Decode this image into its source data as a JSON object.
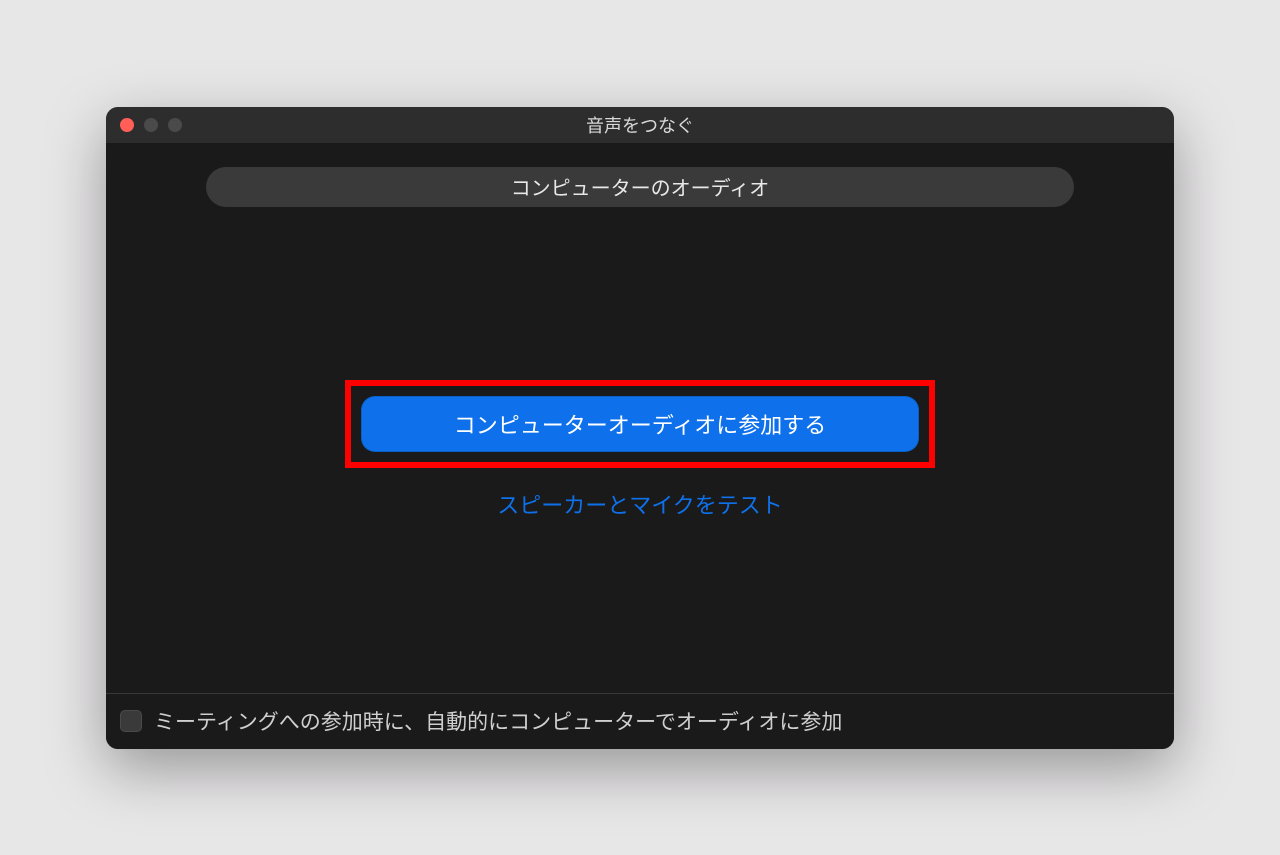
{
  "window": {
    "title": "音声をつなぐ"
  },
  "tab": {
    "computer_audio": "コンピューターのオーディオ"
  },
  "actions": {
    "join_with_computer_audio": "コンピューターオーディオに参加する",
    "test_speaker_and_mic": "スピーカーとマイクをテスト"
  },
  "footer": {
    "auto_join_audio_label": "ミーティングへの参加時に、自動的にコンピューターでオーディオに参加"
  },
  "colors": {
    "accent": "#0e71eb",
    "window_bg": "#1a1a1a",
    "highlight": "#ff0000"
  }
}
